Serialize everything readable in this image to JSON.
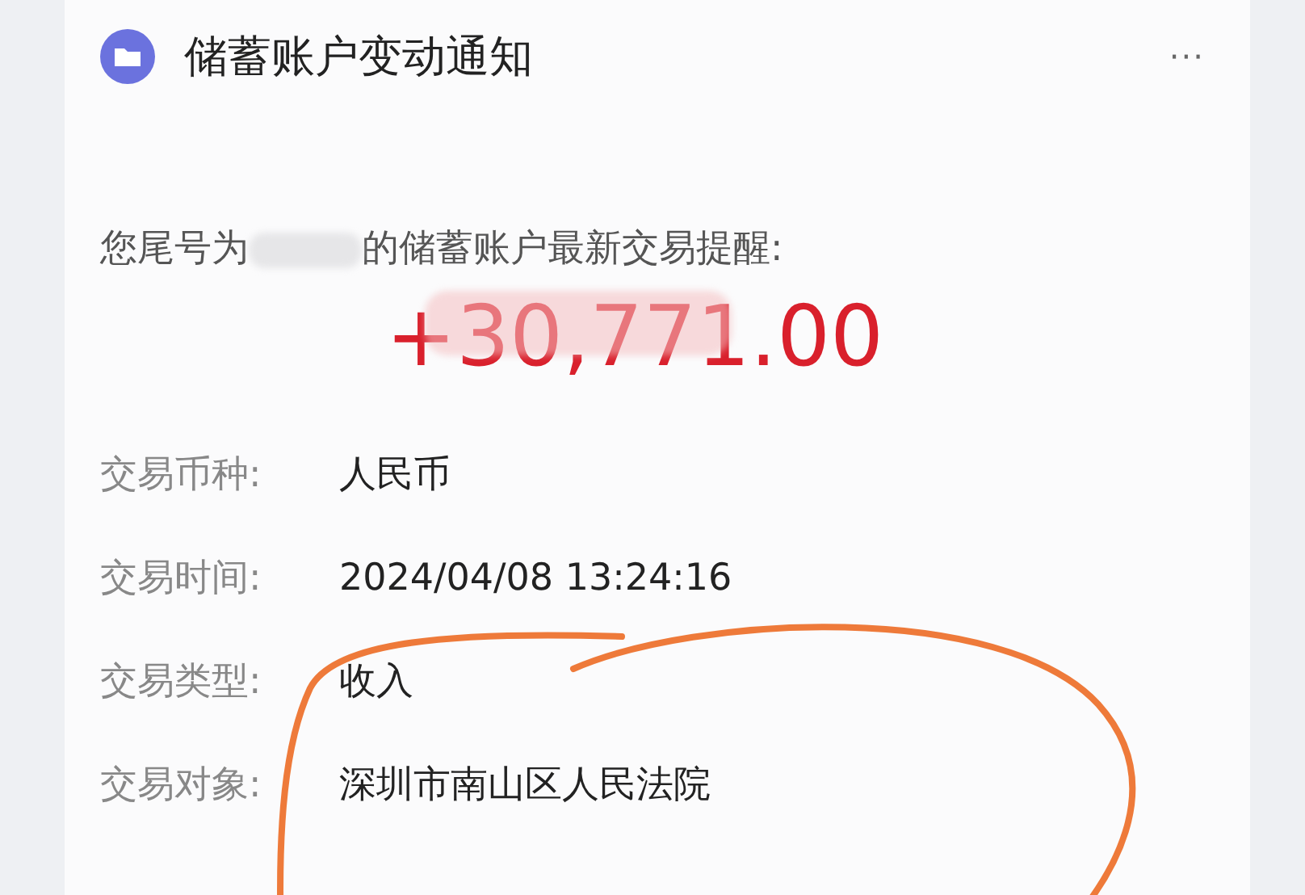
{
  "header": {
    "title": "储蓄账户变动通知",
    "more": "···"
  },
  "message": {
    "prefix": "您尾号为",
    "suffix": "的储蓄账户最新交易提醒:"
  },
  "amount": "+30,771.00",
  "details": [
    {
      "label": "交易币种:",
      "value": "人民币"
    },
    {
      "label": "交易时间:",
      "value": "2024/04/08 13:24:16"
    },
    {
      "label": "交易类型:",
      "value": "收入"
    },
    {
      "label": "交易对象:",
      "value": "深圳市南山区人民法院"
    }
  ]
}
